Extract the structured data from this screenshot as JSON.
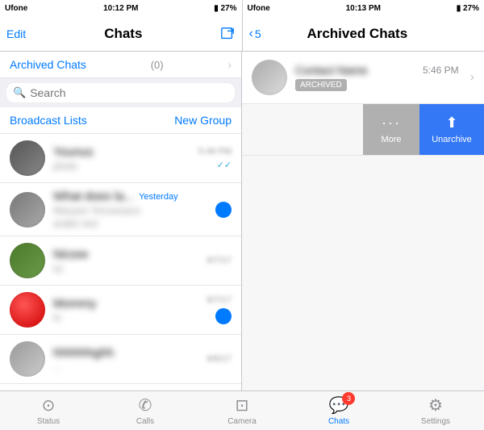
{
  "left_status": {
    "carrier": "Ufone",
    "time": "10:12 PM",
    "battery": "27%"
  },
  "right_status": {
    "carrier": "Ufone",
    "time": "10:13 PM",
    "battery": "27%"
  },
  "left_nav": {
    "edit_label": "Edit",
    "title": "Chats"
  },
  "right_nav": {
    "back_label": "5",
    "title": "Archived Chats"
  },
  "archived_row": {
    "label": "Archived Chats",
    "count": "(0)"
  },
  "search": {
    "placeholder": "Search"
  },
  "broadcast": {
    "label": "Broadcast Lists",
    "new_group": "New Group"
  },
  "chats": [
    {
      "name": "Younus",
      "preview": "photo",
      "time": "5:46 PM",
      "ticks": "✓✓",
      "unread": false
    },
    {
      "name": "What does la...",
      "preview": "Maryam Yenouisace",
      "time": "Yesterday",
      "ticks": "",
      "unread": true
    },
    {
      "name": "Nirzee",
      "preview": "lui",
      "time": "6/7/17",
      "ticks": "",
      "unread": false
    },
    {
      "name": "Mommy",
      "preview": "hi",
      "time": "6/7/17",
      "ticks": "",
      "unread": true
    },
    {
      "name": "hhhhhhghh",
      "preview": "...",
      "time": "6/6/17",
      "ticks": "",
      "unread": false
    }
  ],
  "archived_chat": {
    "time": "5:46 PM",
    "status": "ARCHIVED"
  },
  "actions": {
    "more_label": "More",
    "unarchive_label": "Unarchive"
  },
  "tabs": [
    {
      "label": "Status",
      "icon": "⊙",
      "active": false
    },
    {
      "label": "Calls",
      "icon": "✆",
      "active": false
    },
    {
      "label": "Camera",
      "icon": "⊡",
      "active": false
    },
    {
      "label": "Chats",
      "icon": "💬",
      "active": true,
      "badge": "3"
    },
    {
      "label": "Settings",
      "icon": "⚙",
      "active": false
    }
  ]
}
